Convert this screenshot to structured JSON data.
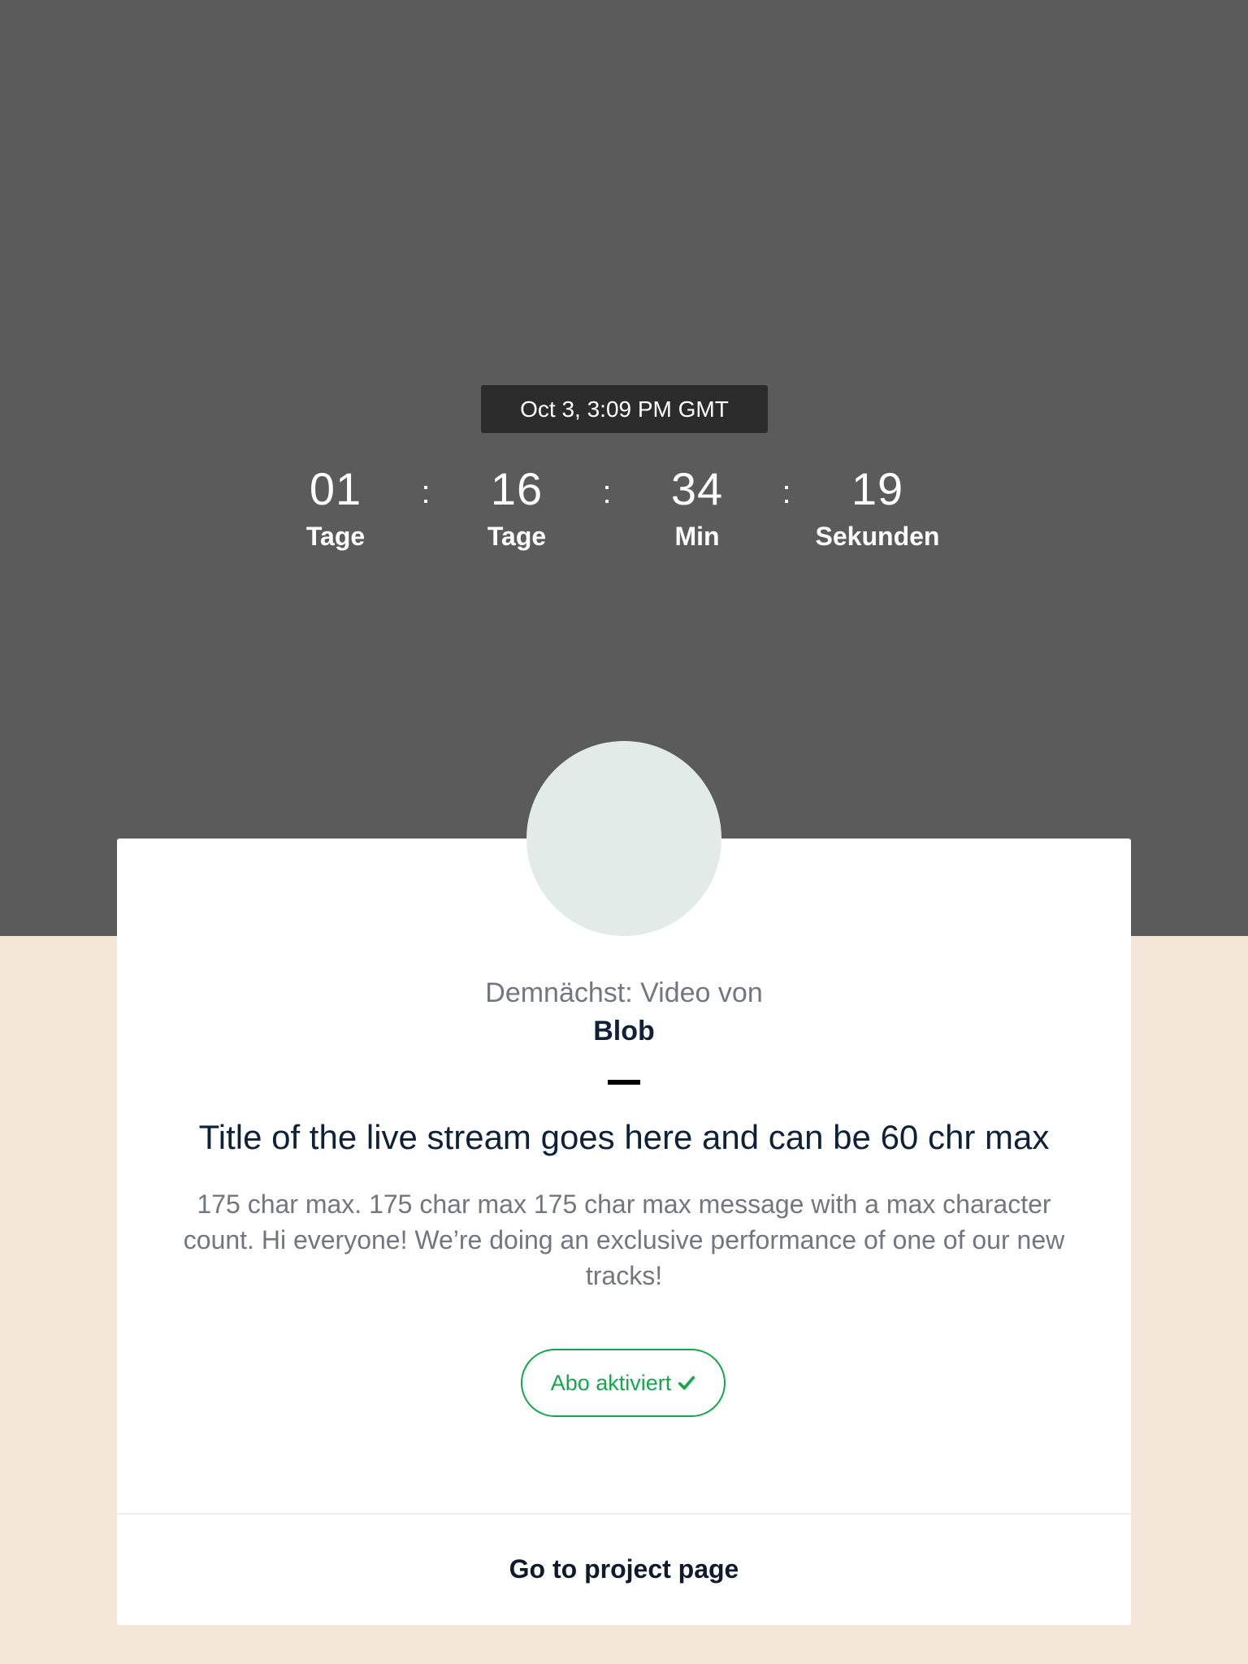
{
  "schedule": {
    "date_label": "Oct 3, 3:09 PM GMT"
  },
  "countdown": {
    "units": [
      {
        "value": "01",
        "label": "Tage"
      },
      {
        "value": "16",
        "label": "Tage"
      },
      {
        "value": "34",
        "label": "Min"
      },
      {
        "value": "19",
        "label": "Sekunden"
      }
    ],
    "separator": ":"
  },
  "card": {
    "subtitle": "Demnächst: Video von",
    "artist": "Blob",
    "title": "Title of the live stream goes here and can be 60 chr max",
    "message": "175 char max. 175 char max 175 char max message with a max character count. Hi everyone! We’re doing an exclusive performance of one of our new tracks!",
    "subscribe_label": "Abo aktiviert",
    "subscribe_icon": "check-icon",
    "project_link_label": "Go to project page"
  },
  "colors": {
    "hero_bg": "#5b5b5b",
    "page_bg": "#f4e6d8",
    "accent_green": "#14a84a",
    "avatar_placeholder": "#e2ebe8"
  }
}
